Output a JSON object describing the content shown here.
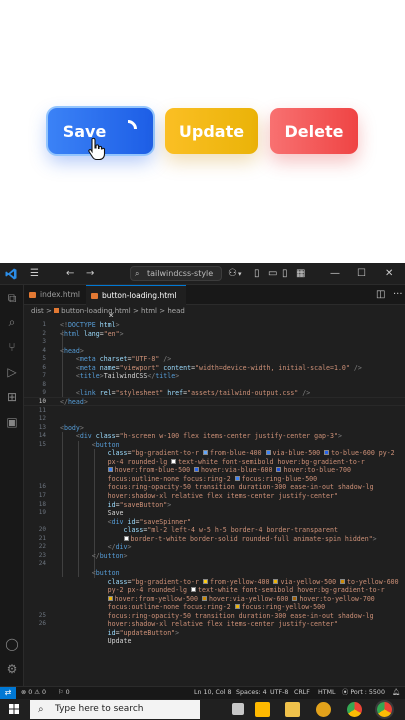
{
  "preview": {
    "buttons": [
      {
        "label": "Save",
        "color": "#3b82f6"
      },
      {
        "label": "Update",
        "color": "#eab308"
      },
      {
        "label": "Delete",
        "color": "#ef4444"
      }
    ]
  },
  "titlebar": {
    "search_text": "tailwindcss-style",
    "icons": [
      "vscode-logo-icon",
      "menu-icon",
      "back-arrow-icon",
      "forward-arrow-icon",
      "copilot-icon",
      "layout-icons",
      "minimize-icon",
      "maximize-icon",
      "close-icon"
    ]
  },
  "tabs": [
    {
      "label": "index.html",
      "active": false
    },
    {
      "label": "button-loading.html",
      "active": true
    }
  ],
  "breadcrumb": {
    "folder": "dist",
    "sep1": ">",
    "file": "button-loading.html",
    "sep2": ">",
    "node1": "html",
    "sep3": ">",
    "node2": "head"
  },
  "editor": {
    "current_line": "10",
    "line_numbers": [
      "1",
      "2",
      "3",
      "4",
      "5",
      "6",
      "7",
      "8",
      "9",
      "10",
      "11",
      "12",
      "13",
      "14",
      "15",
      "",
      "",
      "",
      "",
      "16",
      "17",
      "18",
      "19",
      "",
      "20",
      "21",
      "22",
      "23",
      "24",
      "",
      "",
      "",
      "",
      "",
      "25",
      "26"
    ],
    "lines": [
      {
        "indent": 0,
        "parts": [
          [
            "tg",
            "<!"
          ],
          [
            "tn",
            "DOCTYPE"
          ],
          [
            "an",
            " html"
          ],
          [
            "tg",
            ">"
          ]
        ]
      },
      {
        "indent": 0,
        "parts": [
          [
            "tg",
            "<"
          ],
          [
            "tn",
            "html"
          ],
          [
            "an",
            " lang"
          ],
          [
            "tx",
            "="
          ],
          [
            "av",
            "\"en\""
          ],
          [
            "tg",
            ">"
          ]
        ]
      },
      {
        "indent": 0,
        "parts": []
      },
      {
        "indent": 0,
        "parts": [
          [
            "tg",
            "<"
          ],
          [
            "tn",
            "head"
          ],
          [
            "tg",
            ">"
          ]
        ]
      },
      {
        "indent": 2,
        "parts": [
          [
            "tg",
            "<"
          ],
          [
            "tn",
            "meta"
          ],
          [
            "an",
            " charset"
          ],
          [
            "tx",
            "="
          ],
          [
            "av",
            "\"UTF-8\""
          ],
          [
            "tg",
            " />"
          ]
        ]
      },
      {
        "indent": 2,
        "parts": [
          [
            "tg",
            "<"
          ],
          [
            "tn",
            "meta"
          ],
          [
            "an",
            " name"
          ],
          [
            "tx",
            "="
          ],
          [
            "av",
            "\"viewport\""
          ],
          [
            "an",
            " content"
          ],
          [
            "tx",
            "="
          ],
          [
            "av",
            "\"width=device-width, initial-scale=1.0\""
          ],
          [
            "tg",
            " />"
          ]
        ]
      },
      {
        "indent": 2,
        "parts": [
          [
            "tg",
            "<"
          ],
          [
            "tn",
            "title"
          ],
          [
            "tg",
            ">"
          ],
          [
            "tx",
            "TailwindCSS"
          ],
          [
            "tg",
            "</"
          ],
          [
            "tn",
            "title"
          ],
          [
            "tg",
            ">"
          ]
        ]
      },
      {
        "indent": 0,
        "parts": []
      },
      {
        "indent": 2,
        "parts": [
          [
            "tg",
            "<"
          ],
          [
            "tn",
            "link"
          ],
          [
            "an",
            " rel"
          ],
          [
            "tx",
            "="
          ],
          [
            "av",
            "\"stylesheet\""
          ],
          [
            "an",
            " href"
          ],
          [
            "tx",
            "="
          ],
          [
            "av",
            "\"assets/tailwind-output.css\""
          ],
          [
            "tg",
            " />"
          ]
        ]
      },
      {
        "indent": 0,
        "parts": [
          [
            "tg",
            "</"
          ],
          [
            "tn",
            "head"
          ],
          [
            "tg",
            ">"
          ]
        ]
      },
      {
        "indent": 0,
        "parts": []
      },
      {
        "indent": 0,
        "parts": []
      },
      {
        "indent": 0,
        "parts": [
          [
            "tg",
            "<"
          ],
          [
            "tn",
            "body"
          ],
          [
            "tg",
            ">"
          ]
        ]
      },
      {
        "indent": 2,
        "parts": [
          [
            "tg",
            "<"
          ],
          [
            "tn",
            "div"
          ],
          [
            "an",
            " class"
          ],
          [
            "tx",
            "="
          ],
          [
            "av",
            "\"h-screen w-100 flex items-center justify-center gap-3\""
          ],
          [
            "tg",
            ">"
          ]
        ]
      },
      {
        "indent": 4,
        "parts": [
          [
            "tg",
            "<"
          ],
          [
            "tn",
            "button"
          ]
        ]
      },
      {
        "indent": 6,
        "parts": [
          [
            "an",
            "class"
          ],
          [
            "tx",
            "="
          ],
          [
            "av",
            "\"bg-gradient-to-r "
          ],
          [
            "sw",
            "#60a5fa"
          ],
          [
            "av",
            "from-blue-400 "
          ],
          [
            "sw",
            "#3b82f6"
          ],
          [
            "av",
            "via-blue-500 "
          ],
          [
            "sw",
            "#2563eb"
          ],
          [
            "av",
            "to-blue-600 py-2"
          ]
        ]
      },
      {
        "indent": 6,
        "parts": [
          [
            "av",
            "px-4 rounded-lg "
          ],
          [
            "sw",
            "#ffffff"
          ],
          [
            "av",
            "text-white font-semibold hover:bg-gradient-to-r"
          ]
        ]
      },
      {
        "indent": 6,
        "parts": [
          [
            "sw",
            "#3b82f6"
          ],
          [
            "av",
            "hover:from-blue-500 "
          ],
          [
            "sw",
            "#2563eb"
          ],
          [
            "av",
            "hover:via-blue-600 "
          ],
          [
            "sw",
            "#1d4ed8"
          ],
          [
            "av",
            "hover:to-blue-700"
          ]
        ]
      },
      {
        "indent": 6,
        "parts": [
          [
            "av",
            "focus:outline-none focus:ring-2 "
          ],
          [
            "sw",
            "#3b82f6"
          ],
          [
            "av",
            "focus:ring-blue-500"
          ]
        ]
      },
      {
        "indent": 6,
        "parts": [
          [
            "av",
            "focus:ring-opacity-50 transition duration-300 ease-in-out shadow-lg"
          ]
        ]
      },
      {
        "indent": 6,
        "parts": [
          [
            "av",
            "hover:shadow-xl relative flex items-center justify-center\""
          ]
        ]
      },
      {
        "indent": 6,
        "parts": [
          [
            "an",
            "id"
          ],
          [
            "tx",
            "="
          ],
          [
            "av",
            "\"saveButton\""
          ],
          [
            "tg",
            ">"
          ]
        ]
      },
      {
        "indent": 6,
        "parts": [
          [
            "tx",
            "Save"
          ]
        ]
      },
      {
        "indent": 6,
        "parts": [
          [
            "tg",
            "<"
          ],
          [
            "tn",
            "div"
          ],
          [
            "an",
            " id"
          ],
          [
            "tx",
            "="
          ],
          [
            "av",
            "\"saveSpinner\""
          ]
        ]
      },
      {
        "indent": 8,
        "parts": [
          [
            "an",
            "class"
          ],
          [
            "tx",
            "="
          ],
          [
            "av",
            "\"ml-2 left-4 w-5 h-5 border-4 border-transparent"
          ]
        ]
      },
      {
        "indent": 8,
        "parts": [
          [
            "sw",
            "#ffffff"
          ],
          [
            "av",
            "border-t-white border-solid rounded-full animate-spin hidden\""
          ],
          [
            "tg",
            ">"
          ]
        ]
      },
      {
        "indent": 6,
        "parts": [
          [
            "tg",
            "</"
          ],
          [
            "tn",
            "div"
          ],
          [
            "tg",
            ">"
          ]
        ]
      },
      {
        "indent": 4,
        "parts": [
          [
            "tg",
            "</"
          ],
          [
            "tn",
            "button"
          ],
          [
            "tg",
            ">"
          ]
        ]
      },
      {
        "indent": 0,
        "parts": []
      },
      {
        "indent": 4,
        "parts": [
          [
            "tg",
            "<"
          ],
          [
            "tn",
            "button"
          ]
        ]
      },
      {
        "indent": 6,
        "parts": [
          [
            "an",
            "class"
          ],
          [
            "tx",
            "="
          ],
          [
            "av",
            "\"bg-gradient-to-r "
          ],
          [
            "sw",
            "#facc15"
          ],
          [
            "av",
            "from-yellow-400 "
          ],
          [
            "sw",
            "#eab308"
          ],
          [
            "av",
            "via-yellow-500 "
          ],
          [
            "sw",
            "#ca8a04"
          ],
          [
            "av",
            "to-yellow-600"
          ]
        ]
      },
      {
        "indent": 6,
        "parts": [
          [
            "av",
            "py-2 px-4 rounded-lg "
          ],
          [
            "sw",
            "#ffffff"
          ],
          [
            "av",
            "text-white font-semibold hover:bg-gradient-to-r"
          ]
        ]
      },
      {
        "indent": 6,
        "parts": [
          [
            "sw",
            "#eab308"
          ],
          [
            "av",
            "hover:from-yellow-500 "
          ],
          [
            "sw",
            "#ca8a04"
          ],
          [
            "av",
            "hover:via-yellow-600 "
          ],
          [
            "sw",
            "#a16207"
          ],
          [
            "av",
            "hover:to-yellow-700"
          ]
        ]
      },
      {
        "indent": 6,
        "parts": [
          [
            "av",
            "focus:outline-none focus:ring-2 "
          ],
          [
            "sw",
            "#eab308"
          ],
          [
            "av",
            "focus:ring-yellow-500"
          ]
        ]
      },
      {
        "indent": 6,
        "parts": [
          [
            "av",
            "focus:ring-opacity-50 transition duration-300 ease-in-out shadow-lg"
          ]
        ]
      },
      {
        "indent": 6,
        "parts": [
          [
            "av",
            "hover:shadow-xl relative flex items-center justify-center\""
          ]
        ]
      },
      {
        "indent": 6,
        "parts": [
          [
            "an",
            "id"
          ],
          [
            "tx",
            "="
          ],
          [
            "av",
            "\"updateButton\""
          ],
          [
            "tg",
            ">"
          ]
        ]
      },
      {
        "indent": 6,
        "parts": [
          [
            "tx",
            "Update"
          ]
        ]
      }
    ]
  },
  "statusbar": {
    "errors": "0",
    "warnings": "0",
    "info": "0",
    "position": "Ln 10, Col 8",
    "spaces": "Spaces: 4",
    "encoding": "UTF-8",
    "eol": "CRLF",
    "language": "HTML",
    "port": "Port : 5500"
  },
  "taskbar": {
    "search_placeholder": "Type here to search"
  }
}
